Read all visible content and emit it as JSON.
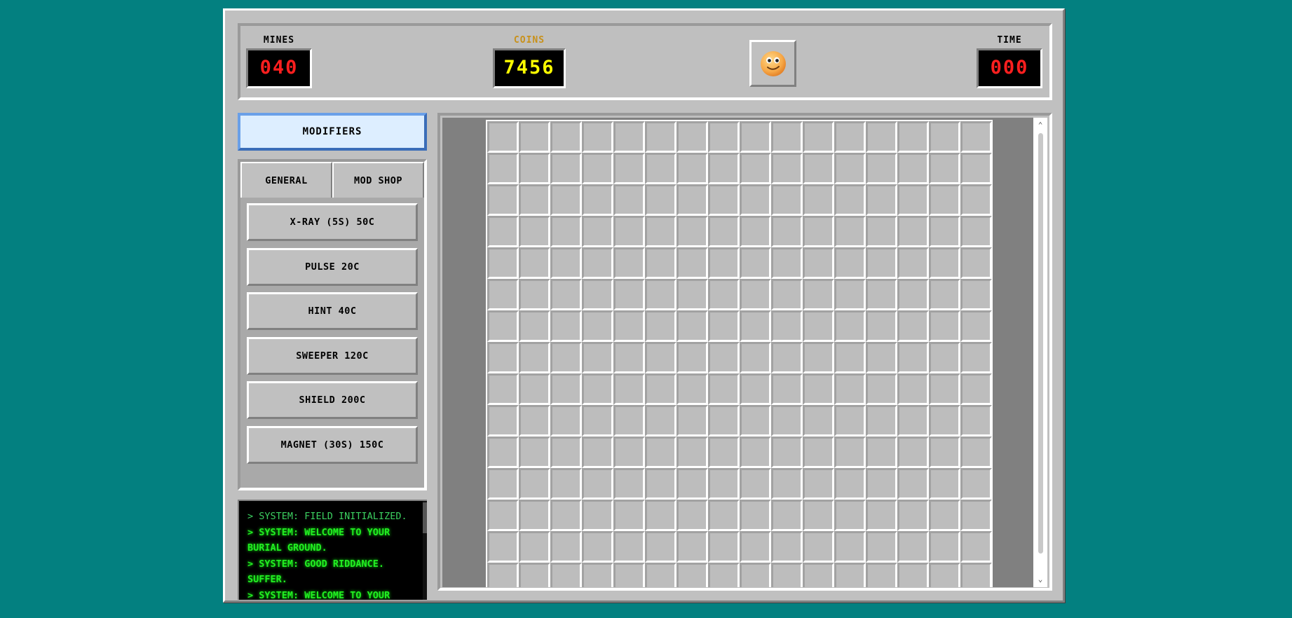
{
  "header": {
    "mines": {
      "label": "MINES",
      "value": "040"
    },
    "coins": {
      "label": "COINS",
      "value": "7456"
    },
    "time": {
      "label": "TIME",
      "value": "000"
    },
    "face": {
      "icon": "smiley-face-icon"
    }
  },
  "sidebar": {
    "modifiers_label": "MODIFIERS",
    "tabs": [
      {
        "label": "GENERAL"
      },
      {
        "label": "MOD SHOP"
      }
    ],
    "shop_items": [
      {
        "label": "X-RAY (5S) 50C"
      },
      {
        "label": "PULSE 20C"
      },
      {
        "label": "HINT 40C"
      },
      {
        "label": "SWEEPER 120C"
      },
      {
        "label": "SHIELD 200C"
      },
      {
        "label": "MAGNET (30S) 150C"
      }
    ]
  },
  "log": {
    "lines": [
      "> SYSTEM: FIELD INITIALIZED.",
      "> SYSTEM: WELCOME TO YOUR BURIAL GROUND.",
      "> SYSTEM: GOOD RIDDANCE. SUFFER.",
      "> SYSTEM: WELCOME TO YOUR BURIAL GROUND."
    ]
  },
  "board": {
    "columns": 16,
    "visible_rows": 15
  },
  "colors": {
    "desktop": "#038080",
    "lcd_red": "#ff1f1f",
    "lcd_yellow": "#ffff00",
    "coins_label": "#c8911a",
    "log_green": "#22ee22",
    "modifiers_accent": "#3a6db8"
  }
}
